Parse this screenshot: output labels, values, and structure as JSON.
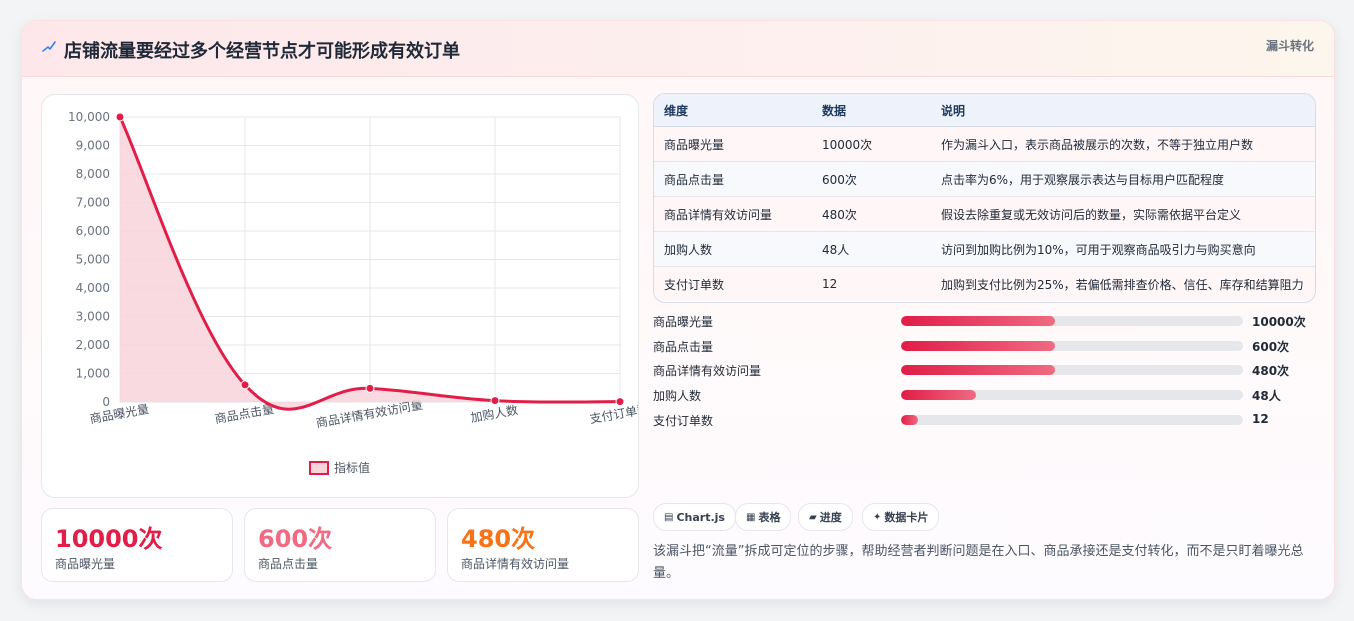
{
  "header": {
    "title": "店铺流量要经过多个经营节点才可能形成有效订单",
    "badge": "漏斗转化"
  },
  "chart_data": {
    "type": "area",
    "categories": [
      "商品曝光量",
      "商品点击量",
      "商品详情有效访问量",
      "加购人数",
      "支付订单数"
    ],
    "series": [
      {
        "name": "指标值",
        "values": [
          10000,
          600,
          480,
          48,
          12
        ]
      }
    ],
    "yticks": [
      "0",
      "1,000",
      "2,000",
      "3,000",
      "4,000",
      "5,000",
      "6,000",
      "7,000",
      "8,000",
      "9,000",
      "10,000"
    ],
    "ylim": [
      0,
      10000
    ],
    "legend": "bottom",
    "grid": true,
    "color": "#e11d48",
    "fill": "#f9d3dc"
  },
  "stats": [
    {
      "value": "10000次",
      "label": "商品曝光量",
      "color": "#e11d48"
    },
    {
      "value": "600次",
      "label": "商品点击量",
      "color": "#f06a82"
    },
    {
      "value": "480次",
      "label": "商品详情有效访问量",
      "color": "#f97316"
    }
  ],
  "table": {
    "headers": [
      "维度",
      "数据",
      "说明"
    ],
    "rows": [
      [
        "商品曝光量",
        "10000次",
        "作为漏斗入口，表示商品被展示的次数，不等于独立用户数"
      ],
      [
        "商品点击量",
        "600次",
        "点击率为6%，用于观察展示表达与目标用户匹配程度"
      ],
      [
        "商品详情有效访问量",
        "480次",
        "假设去除重复或无效访问后的数量，实际需依据平台定义"
      ],
      [
        "加购人数",
        "48人",
        "访问到加购比例为10%，可用于观察商品吸引力与购买意向"
      ],
      [
        "支付订单数",
        "12",
        "加购到支付比例为25%，若偏低需排查价格、信任、库存和结算阻力"
      ]
    ]
  },
  "progress": [
    {
      "label": "商品曝光量",
      "value": "10000次",
      "pct": 45
    },
    {
      "label": "商品点击量",
      "value": "600次",
      "pct": 45
    },
    {
      "label": "商品详情有效访问量",
      "value": "480次",
      "pct": 45
    },
    {
      "label": "加购人数",
      "value": "48人",
      "pct": 22
    },
    {
      "label": "支付订单数",
      "value": "12",
      "pct": 5
    }
  ],
  "chips": [
    {
      "icon": "▤",
      "label": "Chart.js"
    },
    {
      "icon": "▦",
      "label": "表格"
    },
    {
      "icon": "▰",
      "label": "进度"
    },
    {
      "icon": "✦",
      "label": "数据卡片"
    }
  ],
  "footnote": "该漏斗把“流量”拆成可定位的步骤，帮助经营者判断问题是在入口、商品承接还是支付转化，而不是只盯着曝光总量。"
}
